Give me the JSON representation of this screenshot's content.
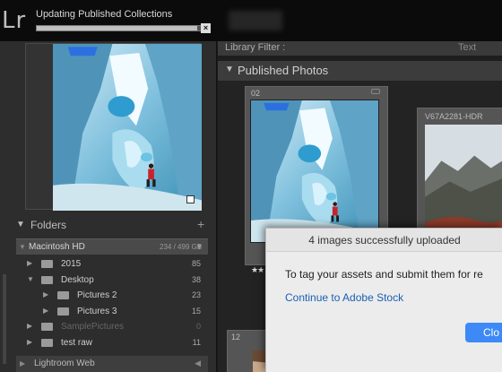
{
  "topbar": {
    "app_logo": "Lr",
    "status": "Updating Published Collections",
    "progress": 0.96,
    "close_symbol": "×"
  },
  "left_panel": {
    "folders_title": "Folders",
    "add_symbol": "+",
    "volume": {
      "name": "Macintosh HD",
      "space": "234 / 499 GB"
    },
    "folders": [
      {
        "name": "2015",
        "count": "85",
        "expanded": false,
        "depth": 0
      },
      {
        "name": "Desktop",
        "count": "38",
        "expanded": true,
        "depth": 0
      },
      {
        "name": "Pictures 2",
        "count": "23",
        "expanded": false,
        "depth": 1
      },
      {
        "name": "Pictures 3",
        "count": "15",
        "expanded": false,
        "depth": 1
      },
      {
        "name": "SamplePictures",
        "count": "0",
        "expanded": false,
        "depth": 0,
        "missing": true
      },
      {
        "name": "test raw",
        "count": "11",
        "expanded": false,
        "depth": 0
      }
    ],
    "lightroom_web": "Lightroom Web"
  },
  "center": {
    "filter_label": "Library Filter :",
    "filter_text": "Text",
    "section_title": "Published Photos",
    "cells": [
      {
        "index": "02",
        "name": "",
        "rating": "★★"
      },
      {
        "index": "",
        "name": "V67A2281-HDR",
        "rating": ""
      },
      {
        "index": "12",
        "name": "",
        "rating": ""
      }
    ]
  },
  "dialog": {
    "title": "4 images successfully uploaded",
    "message": "To tag your assets and submit them for re",
    "link": "Continue to Adobe Stock",
    "button": "Clo"
  },
  "colors": {
    "accent_button": "#3d8af7",
    "link": "#1a5fb4",
    "panel_bg": "#2d2d2d",
    "topbar_bg": "#0b0b0b"
  },
  "icons": {
    "triangle_open": "▼",
    "triangle_closed": "▶",
    "panel_collapse": "◀"
  }
}
